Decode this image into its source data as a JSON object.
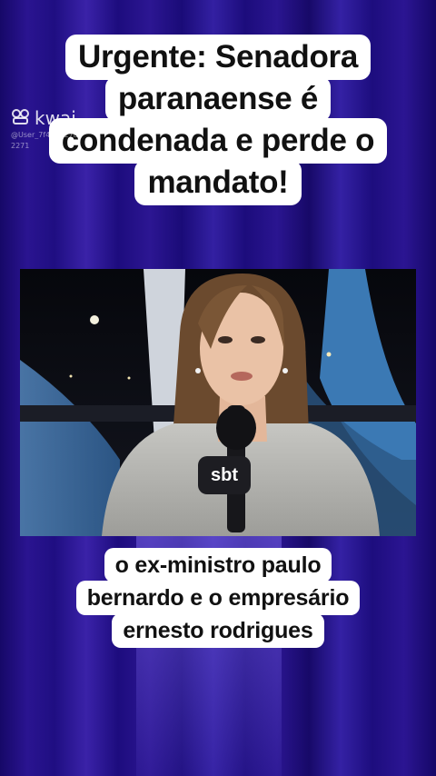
{
  "headline": {
    "lines": [
      "Urgente: Senadora",
      "paranaense é",
      "condenada e perde o",
      "mandato!"
    ]
  },
  "watermark": {
    "brand": "kwai",
    "user": "@User_7f4d3027a5",
    "user_id": "2271"
  },
  "video": {
    "mic_logo": "sbt"
  },
  "caption": {
    "lines": [
      "o ex-ministro paulo",
      "bernardo e o empresário",
      "ernesto rodrigues"
    ]
  },
  "colors": {
    "background": "#23107a",
    "text_box": "#ffffff",
    "text": "#111111"
  }
}
